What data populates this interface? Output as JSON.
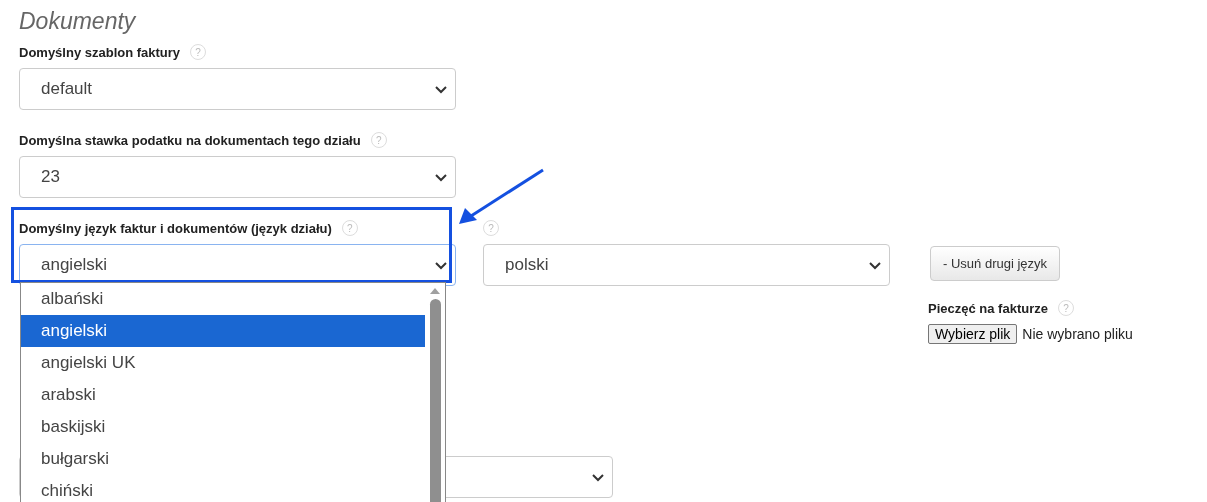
{
  "section_title": "Dokumenty",
  "fields": [
    {
      "label": "Domyślny szablon faktury",
      "help": "?",
      "value": "default"
    },
    {
      "label": "Domyślna stawka podatku na dokumentach tego działu",
      "help": "?",
      "value": "23"
    }
  ],
  "language": {
    "label": "Domyślny język faktur i dokumentów (język działu)",
    "help": "?",
    "second_help": "?",
    "value": "angielski",
    "second_value": "polski",
    "remove_button": "- Usuń drugi język",
    "options": [
      {
        "label": "albański",
        "selected": false
      },
      {
        "label": "angielski",
        "selected": true
      },
      {
        "label": "angielski UK",
        "selected": false
      },
      {
        "label": "arabski",
        "selected": false
      },
      {
        "label": "baskijski",
        "selected": false
      },
      {
        "label": "bułgarski",
        "selected": false
      },
      {
        "label": "chiński",
        "selected": false
      }
    ]
  },
  "stamp": {
    "label": "Pieczęć na fakturze",
    "help": "?",
    "button": "Wybierz plik",
    "status": "Nie wybrano pliku"
  }
}
